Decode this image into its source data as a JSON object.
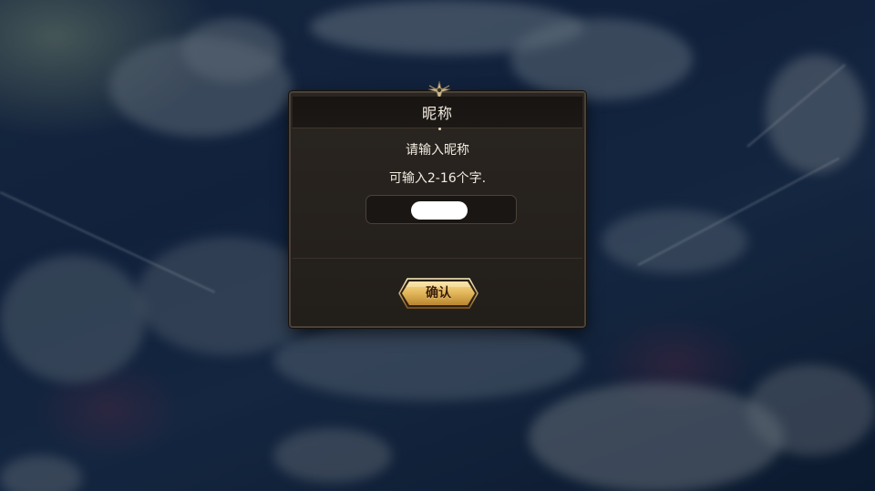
{
  "dialog": {
    "title": "昵称",
    "prompt": "请输入昵称",
    "hint": "可输入2-16个字.",
    "name_input": {
      "value": "",
      "placeholder": ""
    },
    "confirm_label": "确认"
  },
  "colors": {
    "panel_bg": "#221e1a",
    "header_bg": "#171411",
    "gold_button": "#e2b65a",
    "text": "#f1ebe0",
    "sky": "#1a2f4f"
  },
  "icons": {
    "header_ornament": "star-crest-icon"
  }
}
